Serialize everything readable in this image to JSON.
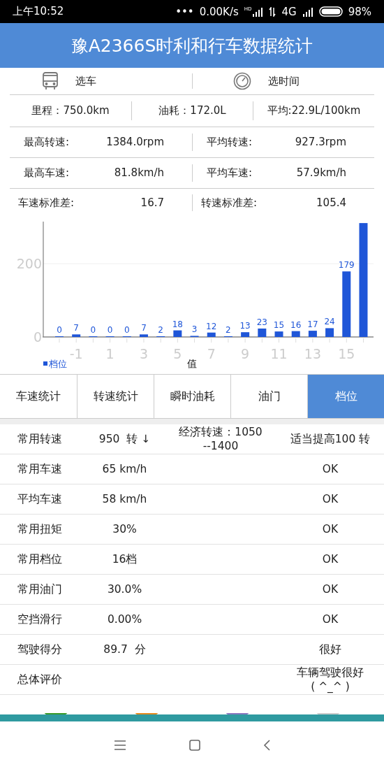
{
  "status_bar": {
    "time": "上午10:52",
    "dots": "•••",
    "speed": "0.00K/s",
    "network": "4G",
    "signal_badge": "HD",
    "battery": "98%"
  },
  "title": "豫A2366S时利和行车数据统计",
  "pickers": [
    {
      "kind": "bus",
      "label": "选车"
    },
    {
      "kind": "clock",
      "label": "选时间"
    }
  ],
  "totals": [
    "里程：750.0km",
    "油耗：172.0L",
    "平均:22.9L/100km"
  ],
  "stats": [
    {
      "cells": [
        {
          "label": "最高转速:",
          "value": "1384.0rpm"
        },
        {
          "label": "平均转速:",
          "value": "927.3rpm"
        }
      ]
    },
    {
      "cells": [
        {
          "label": "最高车速:",
          "value": "81.8km/h"
        },
        {
          "label": "平均车速:",
          "value": "57.9km/h"
        }
      ]
    },
    {
      "cells": [
        {
          "label": "车速标准差:",
          "value": "16.7"
        },
        {
          "label": "转速标准差:",
          "value": "105.4"
        }
      ]
    }
  ],
  "chart": {
    "chart_data": {
      "type": "bar",
      "xlabel": "值",
      "x": [
        -2,
        -1,
        0,
        1,
        2,
        3,
        4,
        5,
        6,
        7,
        8,
        9,
        10,
        11,
        12,
        13,
        14,
        15,
        16
      ],
      "series": [
        {
          "name": "档位",
          "color": "#1f56d8",
          "values": [
            0,
            7,
            0,
            0,
            0,
            7,
            2,
            18,
            3,
            12,
            2,
            13,
            23,
            15,
            16,
            17,
            24,
            179,
            311
          ]
        }
      ],
      "value_labels": [
        "0",
        "7",
        "0",
        "0",
        "0",
        "7",
        "2",
        "18",
        "3",
        "12",
        "2",
        "13",
        "23",
        "15",
        "16",
        "17",
        "24",
        "179",
        null
      ],
      "xlim": [
        -2.95,
        16.6
      ],
      "ylim": [
        0,
        315
      ],
      "yticks": [
        0,
        200
      ],
      "xticks": [
        -1,
        1,
        3,
        5,
        7,
        9,
        11,
        13,
        15
      ]
    }
  },
  "tabs": [
    {
      "label": "车速统计",
      "selected": false
    },
    {
      "label": "转速统计",
      "selected": false
    },
    {
      "label": "瞬时油耗",
      "selected": false
    },
    {
      "label": "油门",
      "selected": false
    },
    {
      "label": "档位",
      "selected": true
    }
  ],
  "table": {
    "rows": [
      {
        "item": "常用转速",
        "value": "950  转 ↓",
        "note": "经济转速：1050\n--1400",
        "verdict": "适当提高100 转"
      },
      {
        "item": "常用车速",
        "value": "65 km/h",
        "verdict": "OK"
      },
      {
        "item": "平均车速",
        "value": "58 km/h",
        "verdict": "OK"
      },
      {
        "item": "常用扭矩",
        "value": "30%",
        "verdict": "OK"
      },
      {
        "item": "常用档位",
        "value": "16档",
        "verdict": "OK"
      },
      {
        "item": "常用油门",
        "value": "30.0%",
        "verdict": "OK"
      },
      {
        "item": "空挡滑行",
        "value": "0.00%",
        "verdict": "OK"
      },
      {
        "item": "驾驶得分",
        "value": "89.7  分",
        "verdict": "很好"
      },
      {
        "item": "总体评价",
        "verdict": "车辆驾驶很好\n( ^_^ )"
      }
    ]
  }
}
